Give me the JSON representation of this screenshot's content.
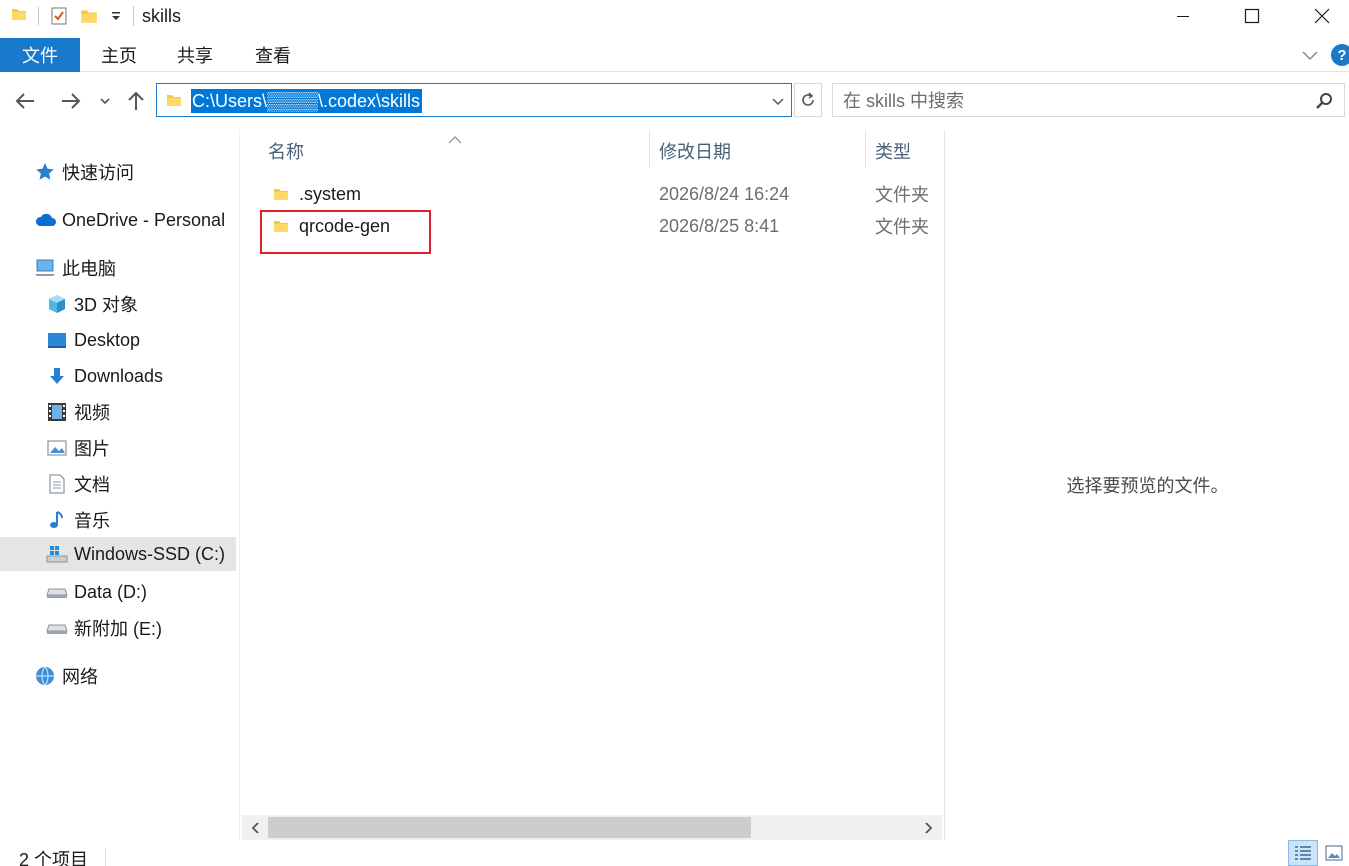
{
  "window": {
    "title": "skills"
  },
  "ribbon": {
    "tabs": [
      "文件",
      "主页",
      "共享",
      "查看"
    ],
    "help_glyph": "?"
  },
  "address": {
    "path": "C:\\Users\\▒▒▒▒\\.codex\\skills",
    "search_placeholder": "在 skills 中搜索"
  },
  "sidebar": {
    "items": [
      {
        "label": "快速访问",
        "icon": "star-icon"
      },
      {
        "label": "OneDrive - Personal",
        "icon": "cloud-icon"
      },
      {
        "label": "此电脑",
        "icon": "computer-icon"
      },
      {
        "label": "3D 对象",
        "icon": "cube-icon"
      },
      {
        "label": "Desktop",
        "icon": "desktop-icon"
      },
      {
        "label": "Downloads",
        "icon": "download-arrow-icon"
      },
      {
        "label": "视频",
        "icon": "film-icon"
      },
      {
        "label": "图片",
        "icon": "picture-icon"
      },
      {
        "label": "文档",
        "icon": "document-icon"
      },
      {
        "label": "音乐",
        "icon": "music-note-icon"
      },
      {
        "label": "Windows-SSD (C:)",
        "icon": "windows-drive-icon",
        "selected": true
      },
      {
        "label": "Data (D:)",
        "icon": "drive-icon"
      },
      {
        "label": "新附加 (E:)",
        "icon": "drive-icon"
      },
      {
        "label": "网络",
        "icon": "network-icon"
      }
    ]
  },
  "filelist": {
    "columns": [
      "名称",
      "修改日期",
      "类型"
    ],
    "rows": [
      {
        "name": ".system",
        "date": "2026/8/24 16:24",
        "type": "文件夹"
      },
      {
        "name": "qrcode-gen",
        "date": "2026/8/25 8:41",
        "type": "文件夹",
        "highlighted": true
      }
    ]
  },
  "preview": {
    "message": "选择要预览的文件。"
  },
  "status": {
    "item_count": "2 个项目"
  },
  "colors": {
    "accent": "#1979ca",
    "selection": "#0078d7",
    "highlight_box": "#e0202a",
    "folder_yellow": "#f5c745"
  }
}
